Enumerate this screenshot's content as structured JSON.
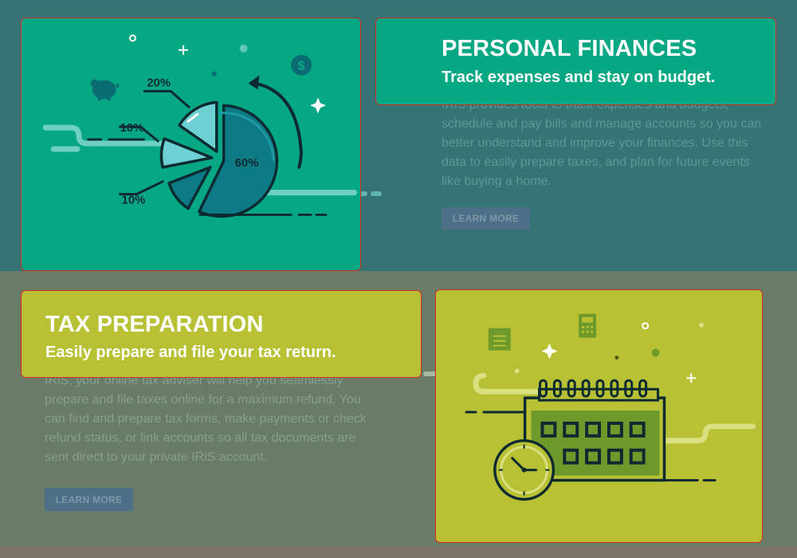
{
  "colors": {
    "top_band": "#357474",
    "bottom_band": "#687c66",
    "footer_band": "#7a7466",
    "personal_card": "#05a883",
    "tax_card": "#b8c134",
    "highlight_border": "#d42a2a",
    "button_bg": "#4d6f88",
    "button_text": "#7f98a8",
    "top_body_text": "#5e9794",
    "bottom_body_text": "#88a08b"
  },
  "personal": {
    "title": "PERSONAL FINANCES",
    "subtitle": "Track expenses and stay on budget.",
    "body": "IRiS provides tools to track expenses and budgets, schedule and pay bills and manage accounts so you can better understand and improve your finances. Use this data to easily prepare taxes, and plan for future events like buying a home.",
    "button_label": "LEARN MORE",
    "illustration": {
      "slice_labels": [
        "20%",
        "10%",
        "10%",
        "60%"
      ],
      "icons": [
        "piggy-bank-icon",
        "dollar-coin-icon",
        "refresh-arrow-icon",
        "pie-chart-icon"
      ]
    }
  },
  "tax": {
    "title": "TAX PREPARATION",
    "subtitle": "Easily prepare and file your tax return.",
    "body": "IRiS, your online tax adviser will help you seamlessly prepare and file taxes online for a maximum refund. You can find and prepare tax forms, make payments or check refund status, or link accounts so all tax documents are sent direct to your private IRiS account.",
    "button_label": "LEARN MORE",
    "illustration": {
      "icons": [
        "notepad-icon",
        "calculator-icon",
        "calendar-icon",
        "clock-icon"
      ]
    }
  }
}
